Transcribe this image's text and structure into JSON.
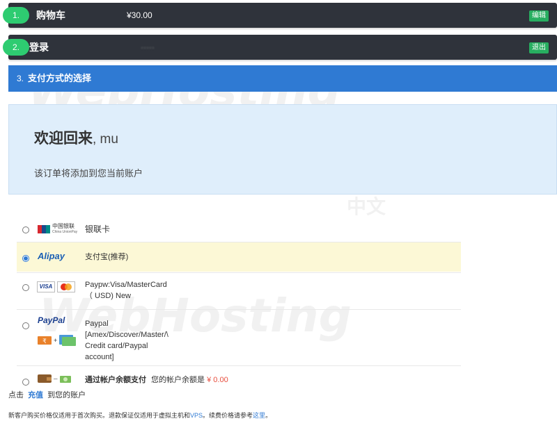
{
  "cart": {
    "step": "1.",
    "title": "购物车",
    "amount": "¥30.00",
    "edit_label": "编辑"
  },
  "login": {
    "step": "2.",
    "title": "登录",
    "account": "·····",
    "logout_label": "退出"
  },
  "payment": {
    "step": "3.",
    "title": "支付方式的选择"
  },
  "welcome": {
    "greeting": "欢迎回来",
    "name": ", mu",
    "note": "该订单将添加到您当前账户"
  },
  "methods": [
    {
      "label": "银联卡",
      "logo": "中国银联",
      "logo_sub": "China UnionPay",
      "selected": false
    },
    {
      "label": "支付宝(推荐)",
      "logo": "Alipay",
      "selected": true
    },
    {
      "label_line1": "Paypw:Visa/MasterCard",
      "label_line2": "（ USD) New",
      "logo1": "VISA",
      "selected": false
    },
    {
      "label_lines": [
        "Paypal",
        "[Amex/Discover/Master/\\",
        "Credit card/Paypal",
        "account]"
      ],
      "logo": "PayPal",
      "selected": false
    },
    {
      "label": "通过帐户余额支付",
      "balance_text": "您的帐户余额是",
      "balance": "¥ 0.00",
      "selected": false
    }
  ],
  "recharge": {
    "prefix": "点击",
    "link": "充值",
    "suffix": "到您的账户"
  },
  "footer": {
    "note": "新客户购买价格仅适用于首次购买。退款保证仅适用于虚拟主机和",
    "vps": "VPS",
    "note2": "。续费价格请参考",
    "link": "这里",
    "end": "。"
  },
  "watermark": {
    "text": "WebHosting",
    "cn": "中文"
  },
  "colors": {
    "dark_bar": "#2f333b",
    "green": "#2ecc71",
    "blue_bar": "#2f7ad3",
    "welcome_bg": "#dfeefb",
    "selected_bg": "#fcf8d6"
  }
}
